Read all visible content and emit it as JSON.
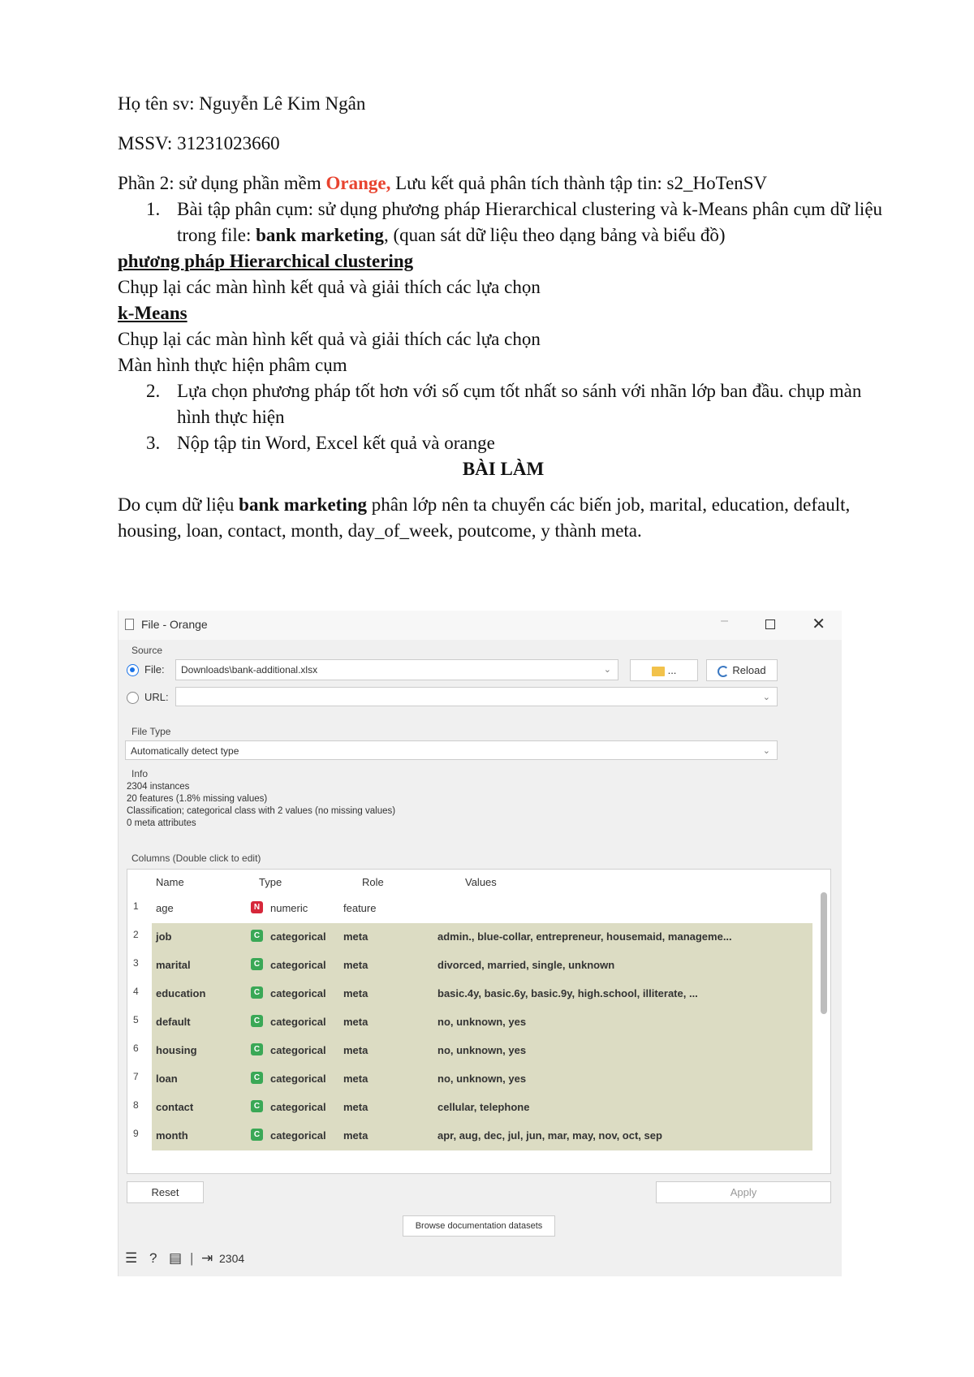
{
  "doc": {
    "student_name": "Họ tên sv: Nguyễn  Lê Kim Ngân",
    "student_id": "MSSV: 31231023660",
    "part2_pre": "Phần 2: sử dụng phần mềm ",
    "part2_orange": "Orange,",
    "part2_post": " Lưu kết quả phân tích thành tập tin: s2_HoTenSV",
    "item1_num": "1.",
    "item1_a": "Bài tập phân cụm: sử dụng phương pháp Hierarchical clustering và k-Means phân cụm dữ liệu trong file: ",
    "item1_bold": "bank marketing",
    "item1_b": ", (quan sát dữ liệu theo dạng bảng và biểu đồ)",
    "heading_hier": "phương pháp Hierarchical clustering",
    "capture1": "Chụp lại các màn hình kết quả và giải thích các lựa chọn",
    "heading_kmeans": "k-Means",
    "capture2": "Chụp lại các màn hình kết quả và giải thích các lựa chọn",
    "screen_line": "Màn hình thực hiện phâm cụm",
    "item2_num": "2.",
    "item2": "Lựa chọn phương pháp tốt hơn với số cụm tốt nhất so sánh với nhãn lớp ban đầu. chụp màn hình thực hiện",
    "item3_num": "3.",
    "item3": "Nộp tập tin Word, Excel kết quả và orange",
    "title": "BÀI LÀM",
    "para_a": "Do cụm dữ liệu ",
    "para_bold": "bank marketing",
    "para_b": " phân lớp nên ta chuyển các biến job, marital, education, default, housing, loan, contact, month, day_of_week, poutcome, y thành meta."
  },
  "window": {
    "title": "File - Orange",
    "source_label": "Source",
    "file_label": "File:",
    "file_path": "Downloads\\bank-additional.xlsx",
    "folder_btn": "...",
    "reload_btn": "Reload",
    "url_label": "URL:",
    "file_type_label": "File Type",
    "file_type_value": "Automatically detect type",
    "info_label": "Info",
    "info_lines": [
      "2304 instances",
      "20 features (1.8% missing values)",
      "Classification; categorical class with 2 values (no missing values)",
      "0 meta attributes"
    ],
    "columns_label": "Columns (Double click to edit)",
    "headers": [
      "Name",
      "Type",
      "Role",
      "Values"
    ],
    "rows": [
      {
        "n": "1",
        "name": "age",
        "t": "N",
        "type": "numeric",
        "role": "feature",
        "values": ""
      },
      {
        "n": "2",
        "name": "job",
        "t": "C",
        "type": "categorical",
        "role": "meta",
        "values": "admin., blue-collar, entrepreneur, housemaid, manageme..."
      },
      {
        "n": "3",
        "name": "marital",
        "t": "C",
        "type": "categorical",
        "role": "meta",
        "values": "divorced, married, single, unknown"
      },
      {
        "n": "4",
        "name": "education",
        "t": "C",
        "type": "categorical",
        "role": "meta",
        "values": "basic.4y, basic.6y, basic.9y, high.school, illiterate, ..."
      },
      {
        "n": "5",
        "name": "default",
        "t": "C",
        "type": "categorical",
        "role": "meta",
        "values": "no, unknown, yes"
      },
      {
        "n": "6",
        "name": "housing",
        "t": "C",
        "type": "categorical",
        "role": "meta",
        "values": "no, unknown, yes"
      },
      {
        "n": "7",
        "name": "loan",
        "t": "C",
        "type": "categorical",
        "role": "meta",
        "values": "no, unknown, yes"
      },
      {
        "n": "8",
        "name": "contact",
        "t": "C",
        "type": "categorical",
        "role": "meta",
        "values": "cellular, telephone"
      },
      {
        "n": "9",
        "name": "month",
        "t": "C",
        "type": "categorical",
        "role": "meta",
        "values": "apr, aug, dec, jul, jun, mar, may, nov, oct, sep"
      }
    ],
    "reset_btn": "Reset",
    "apply_btn": "Apply",
    "browse_btn": "Browse documentation datasets",
    "output_count": "2304"
  }
}
